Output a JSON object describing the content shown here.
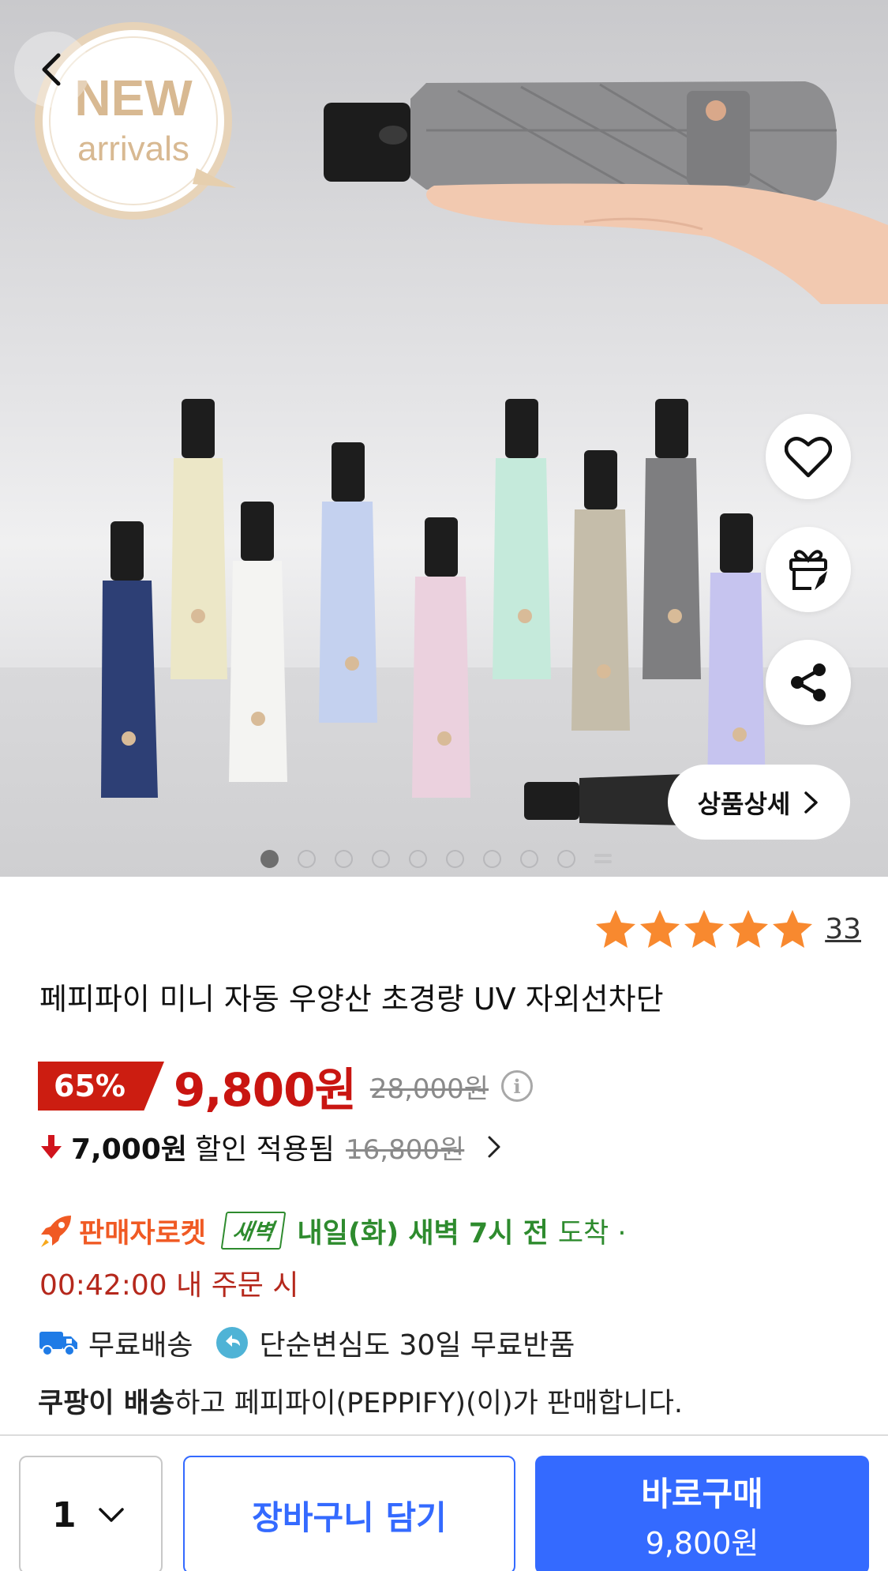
{
  "hero": {
    "badge_line1": "NEW",
    "badge_line2": "arrivals",
    "detail_button_label": "상품상세",
    "image_count": 10,
    "active_index": 0
  },
  "product": {
    "rating": 5,
    "review_count": "33",
    "title": "페피파이 미니 자동 우양산 초경량 UV 자외선차단"
  },
  "price": {
    "discount_rate": "65%",
    "sale_price": "9,800원",
    "original_price": "28,000원"
  },
  "coupon": {
    "amount": "7,000원",
    "text": "할인 적용됨",
    "original": "16,800원"
  },
  "delivery": {
    "type_label": "판매자로켓",
    "dawn_badge": "새벽",
    "arrival_date": "내일(화) 새벽 7시 전",
    "arrival_suffix": "도착 ·",
    "cutoff": "00:42:00 내 주문 시"
  },
  "benefits": {
    "free_shipping": "무료배송",
    "free_return": "단순변심도 30일 무료반품"
  },
  "seller": {
    "shipper": "쿠팡이 배송",
    "rest": "하고 페피파이(PEPPIFY)(이)가 판매합니다."
  },
  "bottom_bar": {
    "quantity": "1",
    "cart_label": "장바구니 담기",
    "buy_label": "바로구매",
    "buy_price": "9,800원"
  },
  "colors": {
    "accent_blue": "#346aff",
    "sale_red": "#c91511",
    "discount_bg": "#cc1d11",
    "rocket_orange": "#f05a24",
    "dawn_green": "#2e8b2e",
    "star": "#f8892f"
  },
  "icons": {
    "back": "chevron-left-icon",
    "wishlist": "heart-icon",
    "gift": "gift-icon",
    "share": "share-icon",
    "detail": "chevron-right-icon",
    "info": "info-icon",
    "down_arrow": "arrow-down-icon",
    "rocket": "rocket-icon",
    "truck": "truck-icon",
    "return": "return-icon",
    "dropdown": "chevron-down-icon"
  }
}
